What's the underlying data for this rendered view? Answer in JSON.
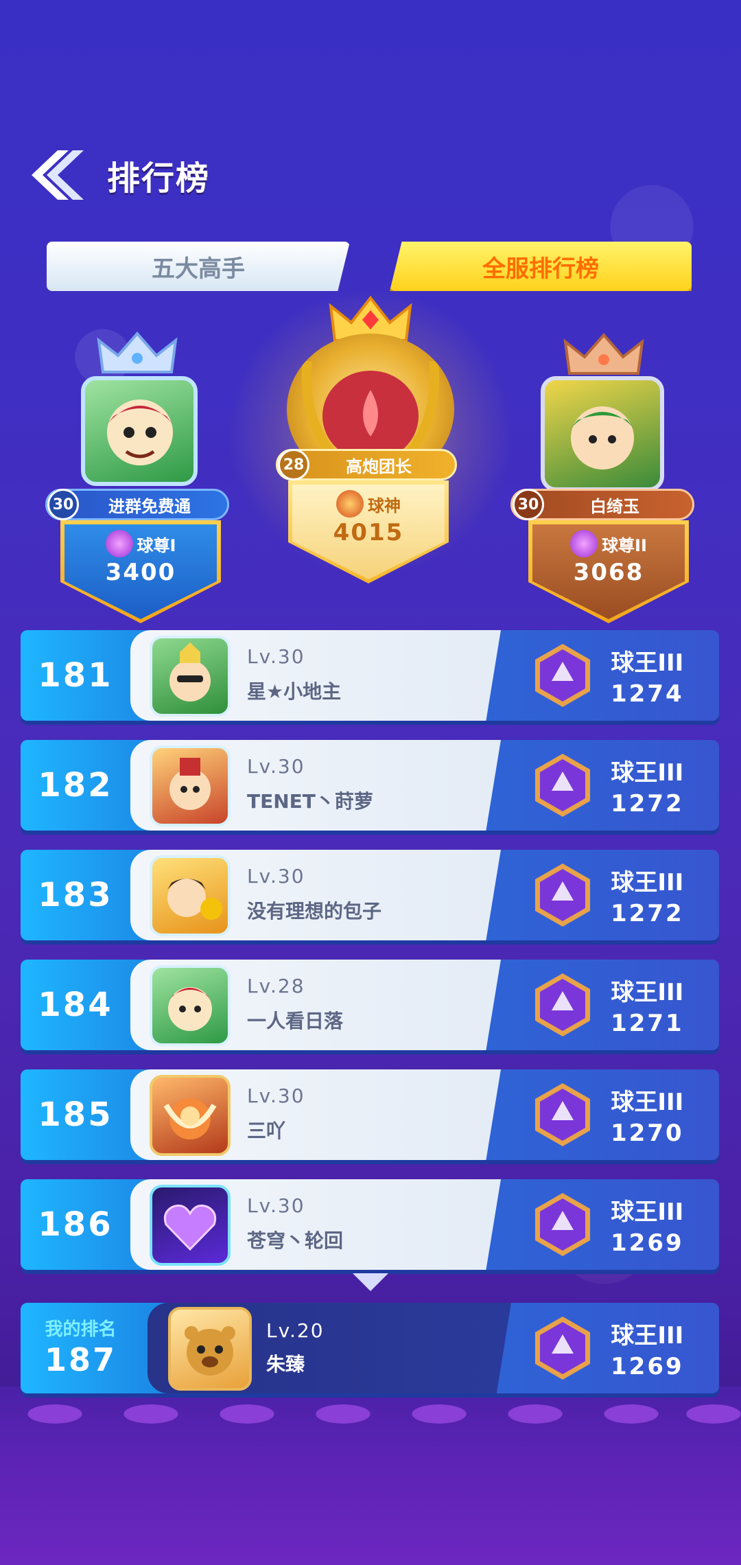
{
  "header": {
    "title": "排行榜"
  },
  "tabs": [
    {
      "label": "五大高手",
      "active": false
    },
    {
      "label": "全服排行榜",
      "active": true
    }
  ],
  "podium": {
    "first": {
      "level": "28",
      "name": "高炮团长",
      "tier": "球神",
      "score": "4015"
    },
    "second": {
      "level": "30",
      "name": "进群免费通",
      "tier": "球尊I",
      "score": "3400"
    },
    "third": {
      "level": "30",
      "name": "白绮玉",
      "tier": "球尊II",
      "score": "3068"
    }
  },
  "list": [
    {
      "rank": "181",
      "level": "Lv.30",
      "name": "星★小地主",
      "tier": "球王III",
      "score": "1274"
    },
    {
      "rank": "182",
      "level": "Lv.30",
      "name": "TENET丶莳萝",
      "tier": "球王III",
      "score": "1272"
    },
    {
      "rank": "183",
      "level": "Lv.30",
      "name": "没有理想的包子",
      "tier": "球王III",
      "score": "1272"
    },
    {
      "rank": "184",
      "level": "Lv.28",
      "name": "一人看日落",
      "tier": "球王III",
      "score": "1271"
    },
    {
      "rank": "185",
      "level": "Lv.30",
      "name": "三吖",
      "tier": "球王III",
      "score": "1270"
    },
    {
      "rank": "186",
      "level": "Lv.30",
      "name": "苍穹丶轮回",
      "tier": "球王III",
      "score": "1269"
    }
  ],
  "my_rank": {
    "label": "我的排名",
    "rank": "187",
    "level": "Lv.20",
    "name": "朱臻",
    "tier": "球王III",
    "score": "1269"
  },
  "colors": {
    "background": "#3f2fc2",
    "tab_active": "#ffd21c",
    "tab_active_text": "#ff6d00",
    "row_blue": "#1c8ce8",
    "gold": "#f2b930"
  }
}
